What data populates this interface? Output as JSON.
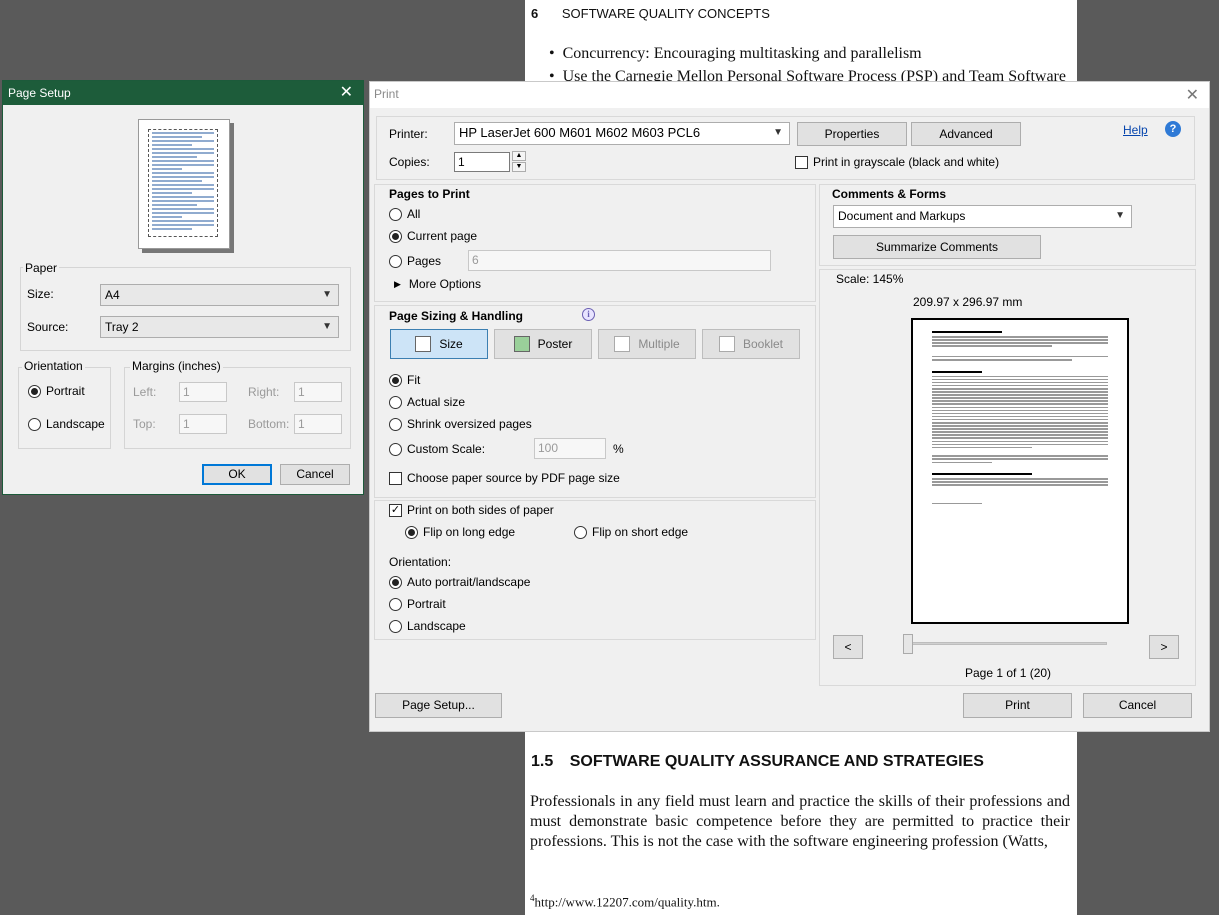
{
  "document": {
    "chapter_number": "6",
    "chapter_title": "SOFTWARE QUALITY CONCEPTS",
    "bullets": [
      "Concurrency: Encouraging multitasking and parallelism",
      "Use the Carnegie Mellon Personal Software Process (PSP) and Team Software"
    ],
    "heading_number": "1.5",
    "heading_text": "SOFTWARE QUALITY ASSURANCE AND STRATEGIES",
    "paragraph": "Professionals in any field must learn and practice the skills of their professions and must demonstrate basic competence before they are permitted to practice their professions. This is not the case with the software engineering profession (Watts,",
    "footnote_mark": "4",
    "footnote_text": "http://www.12207.com/quality.htm."
  },
  "page_setup": {
    "title": "Page Setup",
    "paper_group": "Paper",
    "size_label": "Size:",
    "size_value": "A4",
    "source_label": "Source:",
    "source_value": "Tray 2",
    "orientation_group": "Orientation",
    "portrait": "Portrait",
    "landscape": "Landscape",
    "margins_group": "Margins (inches)",
    "left_label": "Left:",
    "left_value": "1",
    "right_label": "Right:",
    "right_value": "1",
    "top_label": "Top:",
    "top_value": "1",
    "bottom_label": "Bottom:",
    "bottom_value": "1",
    "ok": "OK",
    "cancel": "Cancel"
  },
  "print": {
    "title": "Print",
    "printer_label": "Printer:",
    "printer_value": "HP LaserJet 600 M601 M602 M603 PCL6",
    "properties": "Properties",
    "advanced": "Advanced",
    "help": "Help",
    "copies_label": "Copies:",
    "copies_value": "1",
    "grayscale": "Print in grayscale (black and white)",
    "pages_to_print": "Pages to Print",
    "all": "All",
    "current_page": "Current page",
    "pages": "Pages",
    "pages_value": "6",
    "more_options": "More Options",
    "sizing_title": "Page Sizing & Handling",
    "size_tab": "Size",
    "poster_tab": "Poster",
    "multiple_tab": "Multiple",
    "booklet_tab": "Booklet",
    "fit": "Fit",
    "actual_size": "Actual size",
    "shrink": "Shrink oversized pages",
    "custom_scale": "Custom Scale:",
    "custom_scale_value": "100",
    "percent": "%",
    "choose_source": "Choose paper source by PDF page size",
    "both_sides": "Print on both sides of paper",
    "flip_long": "Flip on long edge",
    "flip_short": "Flip on short edge",
    "orientation_label": "Orientation:",
    "auto_orient": "Auto portrait/landscape",
    "portrait": "Portrait",
    "landscape": "Landscape",
    "comments_title": "Comments & Forms",
    "comments_value": "Document and Markups",
    "summarize": "Summarize Comments",
    "scale_text": "Scale: 145%",
    "page_dims": "209.97 x 296.97 mm",
    "prev": "<",
    "next": ">",
    "page_count": "Page 1 of 1 (20)",
    "page_setup_btn": "Page Setup...",
    "print_btn": "Print",
    "cancel_btn": "Cancel"
  }
}
